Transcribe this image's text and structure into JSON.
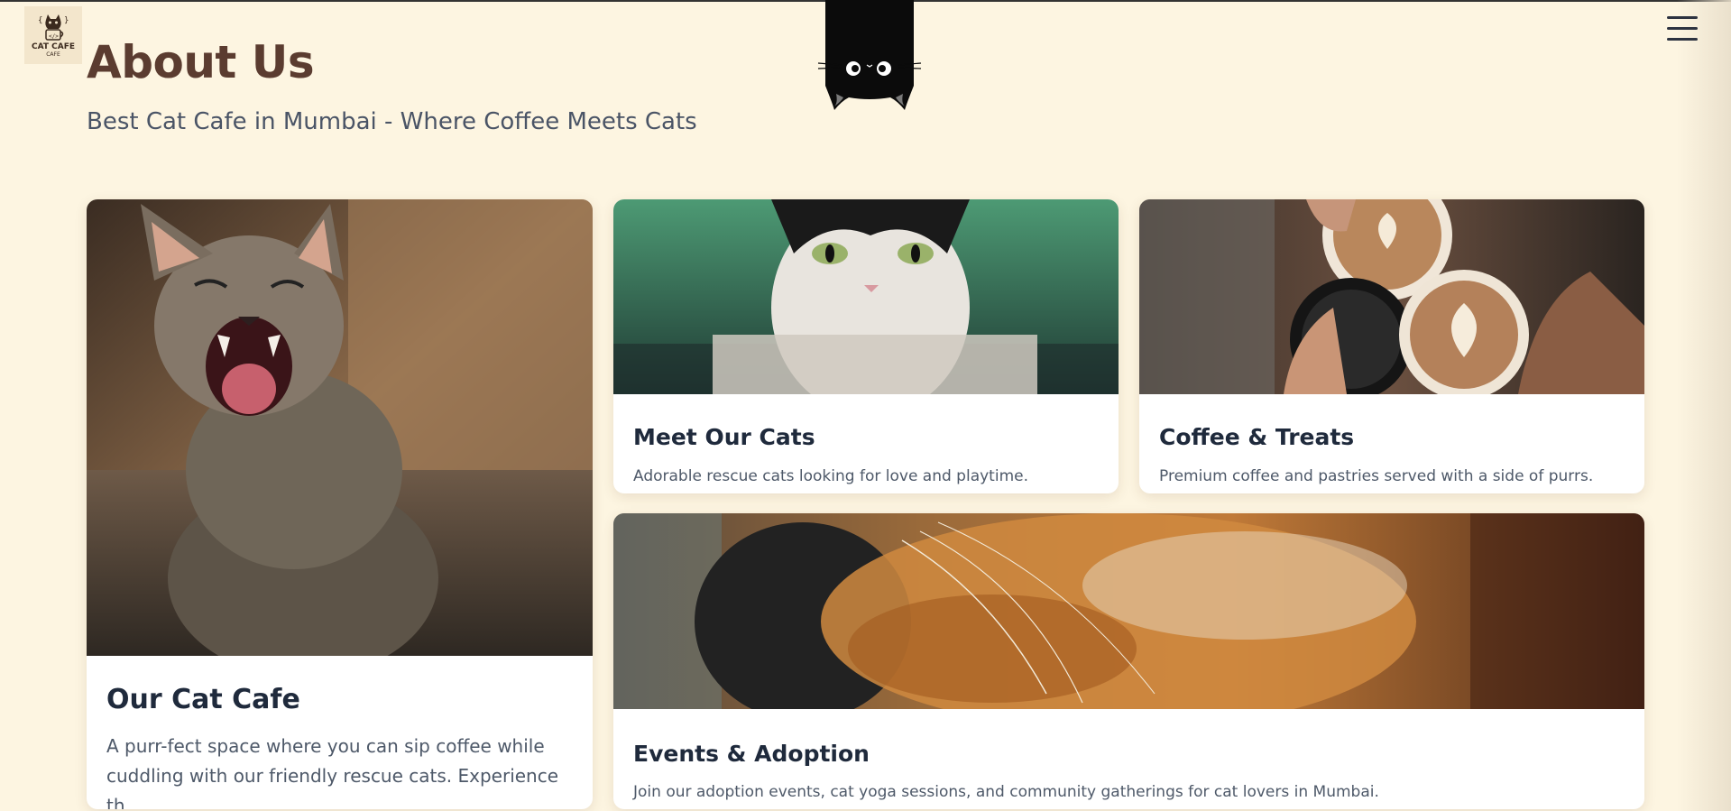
{
  "header": {
    "logo_text": "CAT CAFE",
    "logo_sub": "CAFE",
    "menu_icon": "hamburger-icon"
  },
  "hero": {
    "title": "About Us",
    "subtitle": "Best Cat Cafe in Mumbai - Where Coffee Meets Cats"
  },
  "cards": [
    {
      "title": "Our Cat Cafe",
      "description": "A purr-fect space where you can sip coffee while cuddling with our friendly rescue cats. Experience th..."
    },
    {
      "title": "Meet Our Cats",
      "description": "Adorable rescue cats looking for love and playtime."
    },
    {
      "title": "Coffee & Treats",
      "description": "Premium coffee and pastries served with a side of purrs."
    },
    {
      "title": "Events & Adoption",
      "description": "Join our adoption events, cat yoga sessions, and community gatherings for cat lovers in Mumbai."
    }
  ],
  "colors": {
    "background": "#fdf5e1",
    "title": "#5b3c30",
    "subtitle": "#4a5466",
    "card_title": "#1f2a3c",
    "card_text": "#4e5969"
  }
}
